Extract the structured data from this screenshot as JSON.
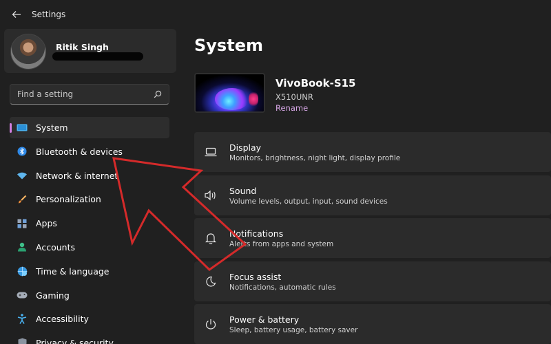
{
  "window": {
    "title": "Settings"
  },
  "profile": {
    "name": "Ritik Singh"
  },
  "search": {
    "placeholder": "Find a setting"
  },
  "sidebar": {
    "items": [
      {
        "label": "System",
        "icon": "monitor-icon",
        "active": true
      },
      {
        "label": "Bluetooth & devices",
        "icon": "bluetooth-icon"
      },
      {
        "label": "Network & internet",
        "icon": "wifi-icon"
      },
      {
        "label": "Personalization",
        "icon": "paintbrush-icon"
      },
      {
        "label": "Apps",
        "icon": "apps-icon"
      },
      {
        "label": "Accounts",
        "icon": "person-icon"
      },
      {
        "label": "Time & language",
        "icon": "globe-clock-icon"
      },
      {
        "label": "Gaming",
        "icon": "gamepad-icon"
      },
      {
        "label": "Accessibility",
        "icon": "accessibility-icon"
      },
      {
        "label": "Privacy & security",
        "icon": "shield-icon"
      }
    ]
  },
  "main": {
    "title": "System",
    "device": {
      "name": "VivoBook-S15",
      "model": "X510UNR",
      "rename_label": "Rename"
    },
    "cards": [
      {
        "title": "Display",
        "desc": "Monitors, brightness, night light, display profile",
        "icon": "display-icon"
      },
      {
        "title": "Sound",
        "desc": "Volume levels, output, input, sound devices",
        "icon": "speaker-icon"
      },
      {
        "title": "Notifications",
        "desc": "Alerts from apps and system",
        "icon": "bell-icon"
      },
      {
        "title": "Focus assist",
        "desc": "Notifications, automatic rules",
        "icon": "moon-icon"
      },
      {
        "title": "Power & battery",
        "desc": "Sleep, battery usage, battery saver",
        "icon": "power-icon"
      }
    ]
  },
  "colors": {
    "background": "#202020",
    "panel": "#2b2b2b",
    "accent": "#d27fe0",
    "annotation_arrow": "#d42a2a"
  }
}
